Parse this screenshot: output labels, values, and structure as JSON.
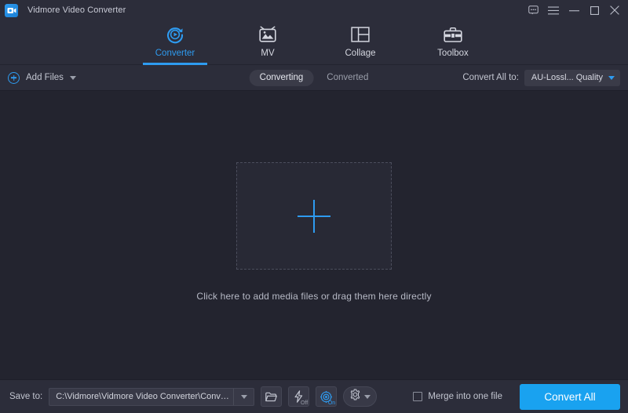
{
  "window": {
    "title": "Vidmore Video Converter",
    "logo_icon": "video-camera-icon",
    "controls": {
      "feedback": "feedback-icon",
      "menu": "hamburger-menu-icon",
      "minimize": "minimize-icon",
      "maximize": "maximize-icon",
      "close": "close-icon"
    }
  },
  "nav": {
    "tabs": [
      {
        "label": "Converter",
        "icon": "converter-icon",
        "active": true
      },
      {
        "label": "MV",
        "icon": "mv-icon",
        "active": false
      },
      {
        "label": "Collage",
        "icon": "collage-icon",
        "active": false
      },
      {
        "label": "Toolbox",
        "icon": "toolbox-icon",
        "active": false
      }
    ]
  },
  "toolbar": {
    "add_files_label": "Add Files",
    "add_files_icon": "plus-circle-icon",
    "add_files_caret": "chevron-down-icon",
    "segments": [
      {
        "label": "Converting",
        "active": true
      },
      {
        "label": "Converted",
        "active": false
      }
    ],
    "convert_all_to_label": "Convert All to:",
    "format_value": "AU-Lossl... Quality",
    "format_caret": "chevron-down-icon"
  },
  "main": {
    "drop_plus_icon": "plus-icon",
    "hint": "Click here to add media files or drag them here directly"
  },
  "bottom": {
    "save_to_label": "Save to:",
    "save_path": "C:\\Vidmore\\Vidmore Video Converter\\Converted",
    "path_caret": "chevron-down-icon",
    "open_folder_icon": "folder-open-icon",
    "hw_accel": {
      "icon": "lightning-bolt-icon",
      "state": "Off"
    },
    "gpu_accel": {
      "icon": "gpu-acceleration-icon",
      "state": "On"
    },
    "settings_icon": "gear-icon",
    "settings_caret": "chevron-down-icon",
    "merge_label": "Merge into one file",
    "merge_checked": false,
    "convert_all_label": "Convert All"
  },
  "colors": {
    "accent": "#2e9bf0",
    "button": "#19a2f0",
    "background": "#23242f",
    "panel": "#2c2d3a",
    "text": "#c2c5d0"
  }
}
